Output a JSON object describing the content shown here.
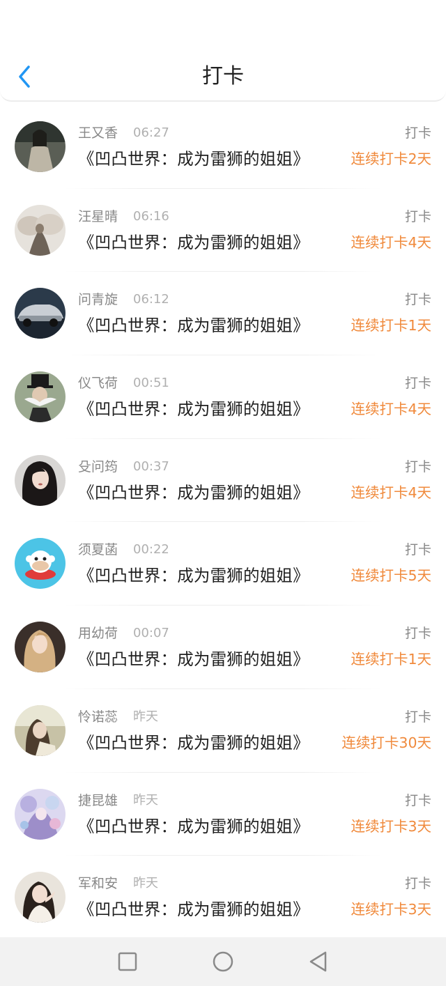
{
  "header": {
    "title": "打卡",
    "back_icon": "chevron-left-icon",
    "accent": "#2196f3"
  },
  "entries": [
    {
      "name": "王又香",
      "time": "06:27",
      "book": "《凹凸世界：成为雷狮的姐姐》",
      "action": "打卡",
      "streak": "连续打卡2天"
    },
    {
      "name": "汪星晴",
      "time": "06:16",
      "book": "《凹凸世界：成为雷狮的姐姐》",
      "action": "打卡",
      "streak": "连续打卡4天"
    },
    {
      "name": "问青旋",
      "time": "06:12",
      "book": "《凹凸世界：成为雷狮的姐姐》",
      "action": "打卡",
      "streak": "连续打卡1天"
    },
    {
      "name": "仪飞荷",
      "time": "00:51",
      "book": "《凹凸世界：成为雷狮的姐姐》",
      "action": "打卡",
      "streak": "连续打卡4天"
    },
    {
      "name": "殳问筠",
      "time": "00:37",
      "book": "《凹凸世界：成为雷狮的姐姐》",
      "action": "打卡",
      "streak": "连续打卡4天"
    },
    {
      "name": "须夏菡",
      "time": "00:22",
      "book": "《凹凸世界：成为雷狮的姐姐》",
      "action": "打卡",
      "streak": "连续打卡5天"
    },
    {
      "name": "用幼荷",
      "time": "00:07",
      "book": "《凹凸世界：成为雷狮的姐姐》",
      "action": "打卡",
      "streak": "连续打卡1天"
    },
    {
      "name": "怜诺蕊",
      "time": "昨天",
      "book": "《凹凸世界：成为雷狮的姐姐》",
      "action": "打卡",
      "streak": "连续打卡30天"
    },
    {
      "name": "捷昆雄",
      "time": "昨天",
      "book": "《凹凸世界：成为雷狮的姐姐》",
      "action": "打卡",
      "streak": "连续打卡3天"
    },
    {
      "name": "军和安",
      "time": "昨天",
      "book": "《凹凸世界：成为雷狮的姐姐》",
      "action": "打卡",
      "streak": "连续打卡3天"
    }
  ],
  "colors": {
    "streak": "#f08a3c",
    "name": "#888888",
    "time": "#b0b0b0",
    "book": "#1f1f1f"
  },
  "navbar": {
    "buttons": [
      "recent-apps-icon",
      "home-icon",
      "back-triangle-icon"
    ]
  }
}
